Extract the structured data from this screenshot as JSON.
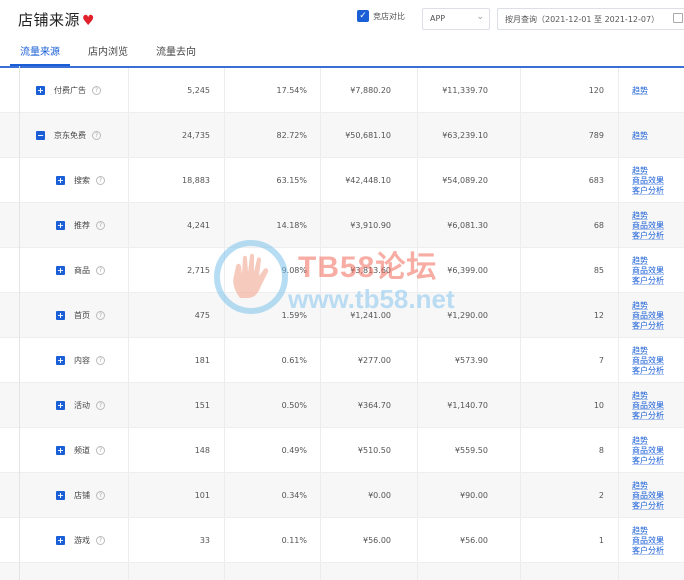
{
  "header": {
    "title": "店铺来源",
    "heart_icon": "heart-icon",
    "compare_label": "竞店对比",
    "compare_checked": true,
    "platform_select": "APP",
    "date_range": "按月查询（2021-12-01 至 2021-12-07）"
  },
  "tabs": [
    {
      "label": "流量来源",
      "active": true
    },
    {
      "label": "店内浏览",
      "active": false
    },
    {
      "label": "流量去向",
      "active": false
    }
  ],
  "colors": {
    "accent": "#1a5fd6",
    "heart": "#e0202a",
    "watermark_red": "#f26b5b",
    "watermark_blue": "#8ac6ef"
  },
  "rows": [
    {
      "level": 0,
      "expander": "+",
      "name": "付费广告",
      "visitors": "5,245",
      "pct": "17.54%",
      "v1": "¥7,880.20",
      "v2": "¥11,339.70",
      "count": "120",
      "links": [
        "趋势"
      ]
    },
    {
      "level": 0,
      "expander": "−",
      "name": "京东免费",
      "visitors": "24,735",
      "pct": "82.72%",
      "v1": "¥50,681.10",
      "v2": "¥63,239.10",
      "count": "789",
      "links": [
        "趋势"
      ]
    },
    {
      "level": 1,
      "expander": "+",
      "name": "搜索",
      "visitors": "18,883",
      "pct": "63.15%",
      "v1": "¥42,448.10",
      "v2": "¥54,089.20",
      "count": "683",
      "links": [
        "趋势",
        "商品效果",
        "客户分析"
      ]
    },
    {
      "level": 1,
      "expander": "+",
      "name": "推荐",
      "visitors": "4,241",
      "pct": "14.18%",
      "v1": "¥3,910.90",
      "v2": "¥6,081.30",
      "count": "68",
      "links": [
        "趋势",
        "商品效果",
        "客户分析"
      ]
    },
    {
      "level": 1,
      "expander": "+",
      "name": "商品",
      "visitors": "2,715",
      "pct": "9.08%",
      "v1": "¥3,813.60",
      "v2": "¥6,399.00",
      "count": "85",
      "links": [
        "趋势",
        "商品效果",
        "客户分析"
      ]
    },
    {
      "level": 1,
      "expander": "+",
      "name": "首页",
      "visitors": "475",
      "pct": "1.59%",
      "v1": "¥1,241.00",
      "v2": "¥1,290.00",
      "count": "12",
      "links": [
        "趋势",
        "商品效果",
        "客户分析"
      ]
    },
    {
      "level": 1,
      "expander": "+",
      "name": "内容",
      "visitors": "181",
      "pct": "0.61%",
      "v1": "¥277.00",
      "v2": "¥573.90",
      "count": "7",
      "links": [
        "趋势",
        "商品效果",
        "客户分析"
      ]
    },
    {
      "level": 1,
      "expander": "+",
      "name": "活动",
      "visitors": "151",
      "pct": "0.50%",
      "v1": "¥364.70",
      "v2": "¥1,140.70",
      "count": "10",
      "links": [
        "趋势",
        "商品效果",
        "客户分析"
      ]
    },
    {
      "level": 1,
      "expander": "+",
      "name": "频道",
      "visitors": "148",
      "pct": "0.49%",
      "v1": "¥510.50",
      "v2": "¥559.50",
      "count": "8",
      "links": [
        "趋势",
        "商品效果",
        "客户分析"
      ]
    },
    {
      "level": 1,
      "expander": "+",
      "name": "店铺",
      "visitors": "101",
      "pct": "0.34%",
      "v1": "¥0.00",
      "v2": "¥90.00",
      "count": "2",
      "links": [
        "趋势",
        "商品效果",
        "客户分析"
      ]
    },
    {
      "level": 1,
      "expander": "+",
      "name": "游戏",
      "visitors": "33",
      "pct": "0.11%",
      "v1": "¥56.00",
      "v2": "¥56.00",
      "count": "1",
      "links": [
        "趋势",
        "商品效果",
        "客户分析"
      ]
    },
    {
      "level": 1,
      "expander": "",
      "name": "",
      "visitors": "",
      "pct": "",
      "v1": "",
      "v2": "",
      "count": "",
      "links": []
    }
  ],
  "watermark": {
    "title": "TB58论坛",
    "url": "www.tb58.net"
  }
}
